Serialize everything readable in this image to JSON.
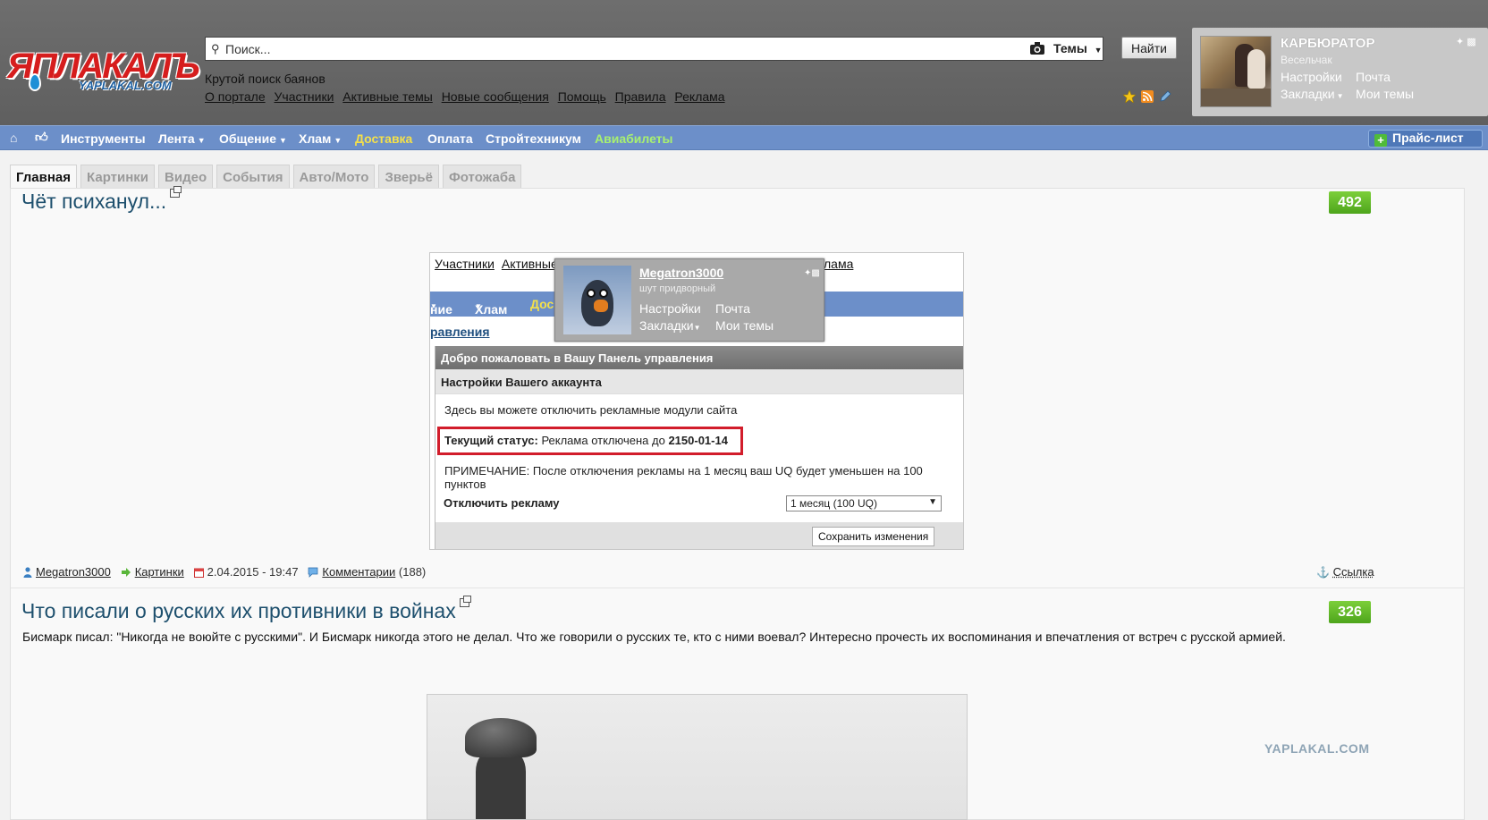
{
  "header": {
    "logo_text": "ЯПЛАКАЛЪ",
    "logo_sub": "YAPLAKAL.COM",
    "search_placeholder": "Поиск...",
    "themes_label": "Темы",
    "find_label": "Найти",
    "tagline": "Крутой поиск баянов",
    "links": [
      "О портале",
      "Участники",
      "Активные темы",
      "Новые сообщения",
      "Помощь",
      "Правила",
      "Реклама"
    ]
  },
  "user": {
    "name": "КАРБЮРАТОР",
    "rank": "Весельчак",
    "settings": "Настройки",
    "mail": "Почта",
    "bookmarks": "Закладки",
    "my_topics": "Мои темы"
  },
  "nav": {
    "items": [
      "Инструменты",
      "Лента",
      "Общение",
      "Хлам",
      "Доставка",
      "Оплата",
      "Стройтехникум",
      "Авиабилеты"
    ],
    "price_list": "Прайс-лист",
    "colors": {
      "bar": "#6c8fc9",
      "delivery": "#f4e04a",
      "avia": "#a8f070"
    }
  },
  "tabs": [
    "Главная",
    "Картинки",
    "Видео",
    "События",
    "Авто/Мото",
    "Зверьё",
    "Фотожаба"
  ],
  "posts": [
    {
      "title": "Чёт психанул...",
      "score": "492",
      "author": "Megatron3000",
      "category": "Картинки",
      "date": "2.04.2015 - 19:47",
      "comments_label": "Комментарии",
      "comments_count": "(188)",
      "link_label": "Ссылка"
    },
    {
      "title": "Что писали о русских их противники в войнах",
      "score": "326",
      "text": "Бисмарк писал: \"Никогда не воюйте с русскими\". И Бисмарк никогда этого не делал. Что же говорили о русских те, кто с ними воевал? Интересно прочесть их воспоминания и впечатления от встреч с русской армией."
    }
  ],
  "embed": {
    "links": [
      "Участники",
      "Активные"
    ],
    "links_tail": "лама",
    "nav": [
      "ние",
      "Хлам",
      "Дос"
    ],
    "link3": "равления",
    "panel_head": "Добро пожаловать в Вашу Панель управления",
    "panel_sub": "Настройки Вашего аккаунта",
    "line1": "Здесь вы можете отключить рекламные модули сайта",
    "status_label": "Текущий статус:",
    "status_text": "Реклама отключена до",
    "status_date": "2150-01-14",
    "note": "ПРИМЕЧАНИЕ: После отключения рекламы на 1 месяц ваш UQ будет уменьшен на 100 пунктов",
    "disable_label": "Отключить рекламу",
    "select_value": "1 месяц (100 UQ)",
    "save_label": "Сохранить изменения",
    "popup": {
      "name": "Megatron3000",
      "rank": "шут придворный",
      "settings": "Настройки",
      "mail": "Почта",
      "bookmarks": "Закладки",
      "my_topics": "Мои темы"
    }
  },
  "watermark": "YAPLAKAL.COM"
}
